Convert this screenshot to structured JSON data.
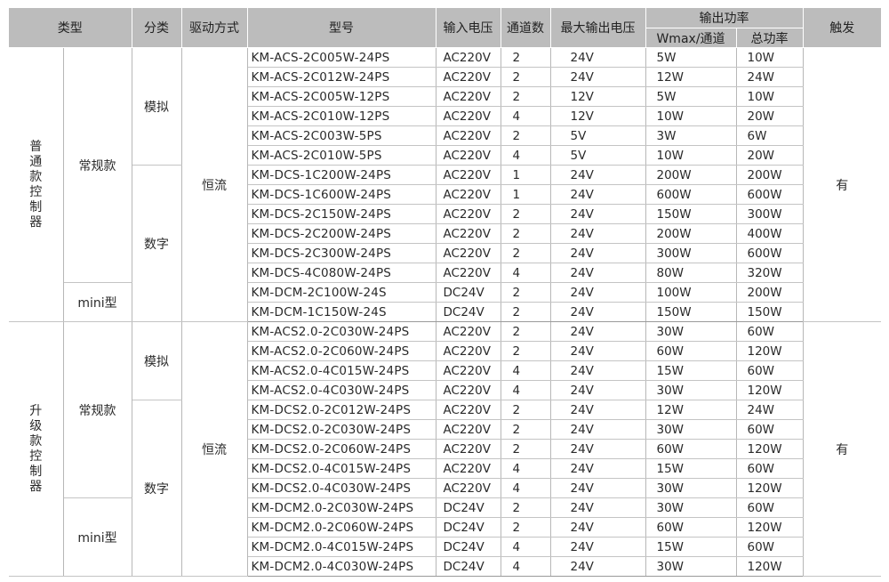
{
  "headers": {
    "type": "类型",
    "category": "分类",
    "drive": "驱动方式",
    "model": "型号",
    "input_voltage": "输入电压",
    "channels": "通道数",
    "max_output_voltage": "最大输出电压",
    "output_power": "输出功率",
    "wmax_per_channel": "Wmax/通道",
    "total_power": "总功率",
    "trigger": "触发"
  },
  "groups": [
    {
      "type_label": "普通款控制器",
      "series_a": "常规款",
      "series_b": "mini型",
      "cat_analog": "模拟",
      "cat_digital": "数字",
      "drive": "恒流",
      "trigger": "有"
    },
    {
      "type_label": "升级款控制器",
      "series_a": "常规款",
      "series_b": "mini型",
      "cat_analog": "模拟",
      "cat_digital": "数字",
      "drive": "恒流",
      "trigger": "有"
    }
  ],
  "rows": [
    [
      "KM-ACS-2C005W-24PS",
      "AC220V",
      "2",
      "24V",
      "5W",
      "10W"
    ],
    [
      "KM-ACS-2C012W-24PS",
      "AC220V",
      "2",
      "24V",
      "12W",
      "24W"
    ],
    [
      "KM-ACS-2C005W-12PS",
      "AC220V",
      "2",
      "12V",
      "5W",
      "10W"
    ],
    [
      "KM-ACS-2C010W-12PS",
      "AC220V",
      "4",
      "12V",
      "10W",
      "20W"
    ],
    [
      "KM-ACS-2C003W-5PS",
      "AC220V",
      "2",
      "5V",
      "3W",
      "6W"
    ],
    [
      "KM-ACS-2C010W-5PS",
      "AC220V",
      "4",
      "5V",
      "10W",
      "20W"
    ],
    [
      "KM-DCS-1C200W-24PS",
      "AC220V",
      "1",
      "24V",
      "200W",
      "200W"
    ],
    [
      "KM-DCS-1C600W-24PS",
      "AC220V",
      "1",
      "24V",
      "600W",
      "600W"
    ],
    [
      "KM-DCS-2C150W-24PS",
      "AC220V",
      "2",
      "24V",
      "150W",
      "300W"
    ],
    [
      "KM-DCS-2C200W-24PS",
      "AC220V",
      "2",
      "24V",
      "200W",
      "400W"
    ],
    [
      "KM-DCS-2C300W-24PS",
      "AC220V",
      "2",
      "24V",
      "300W",
      "600W"
    ],
    [
      "KM-DCS-4C080W-24PS",
      "AC220V",
      "4",
      "24V",
      "80W",
      "320W"
    ],
    [
      "KM-DCM-2C100W-24S",
      "DC24V",
      "2",
      "24V",
      "100W",
      "200W"
    ],
    [
      "KM-DCM-1C150W-24S",
      "DC24V",
      "2",
      "24V",
      "150W",
      "150W"
    ],
    [
      "KM-ACS2.0-2C030W-24PS",
      "AC220V",
      "2",
      "24V",
      "30W",
      "60W"
    ],
    [
      "KM-ACS2.0-2C060W-24PS",
      "AC220V",
      "2",
      "24V",
      "60W",
      "120W"
    ],
    [
      "KM-ACS2.0-4C015W-24PS",
      "AC220V",
      "4",
      "24V",
      "15W",
      "60W"
    ],
    [
      "KM-ACS2.0-4C030W-24PS",
      "AC220V",
      "4",
      "24V",
      "30W",
      "120W"
    ],
    [
      "KM-DCS2.0-2C012W-24PS",
      "AC220V",
      "2",
      "24V",
      "12W",
      "24W"
    ],
    [
      "KM-DCS2.0-2C030W-24PS",
      "AC220V",
      "2",
      "24V",
      "30W",
      "60W"
    ],
    [
      "KM-DCS2.0-2C060W-24PS",
      "AC220V",
      "2",
      "24V",
      "60W",
      "120W"
    ],
    [
      "KM-DCS2.0-4C015W-24PS",
      "AC220V",
      "4",
      "24V",
      "15W",
      "60W"
    ],
    [
      "KM-DCS2.0-4C030W-24PS",
      "AC220V",
      "4",
      "24V",
      "30W",
      "120W"
    ],
    [
      "KM-DCM2.0-2C030W-24PS",
      "DC24V",
      "2",
      "24V",
      "30W",
      "60W"
    ],
    [
      "KM-DCM2.0-2C060W-24PS",
      "DC24V",
      "2",
      "24V",
      "60W",
      "120W"
    ],
    [
      "KM-DCM2.0-4C015W-24PS",
      "DC24V",
      "4",
      "24V",
      "15W",
      "60W"
    ],
    [
      "KM-DCM2.0-4C030W-24PS",
      "DC24V",
      "4",
      "24V",
      "30W",
      "120W"
    ]
  ]
}
